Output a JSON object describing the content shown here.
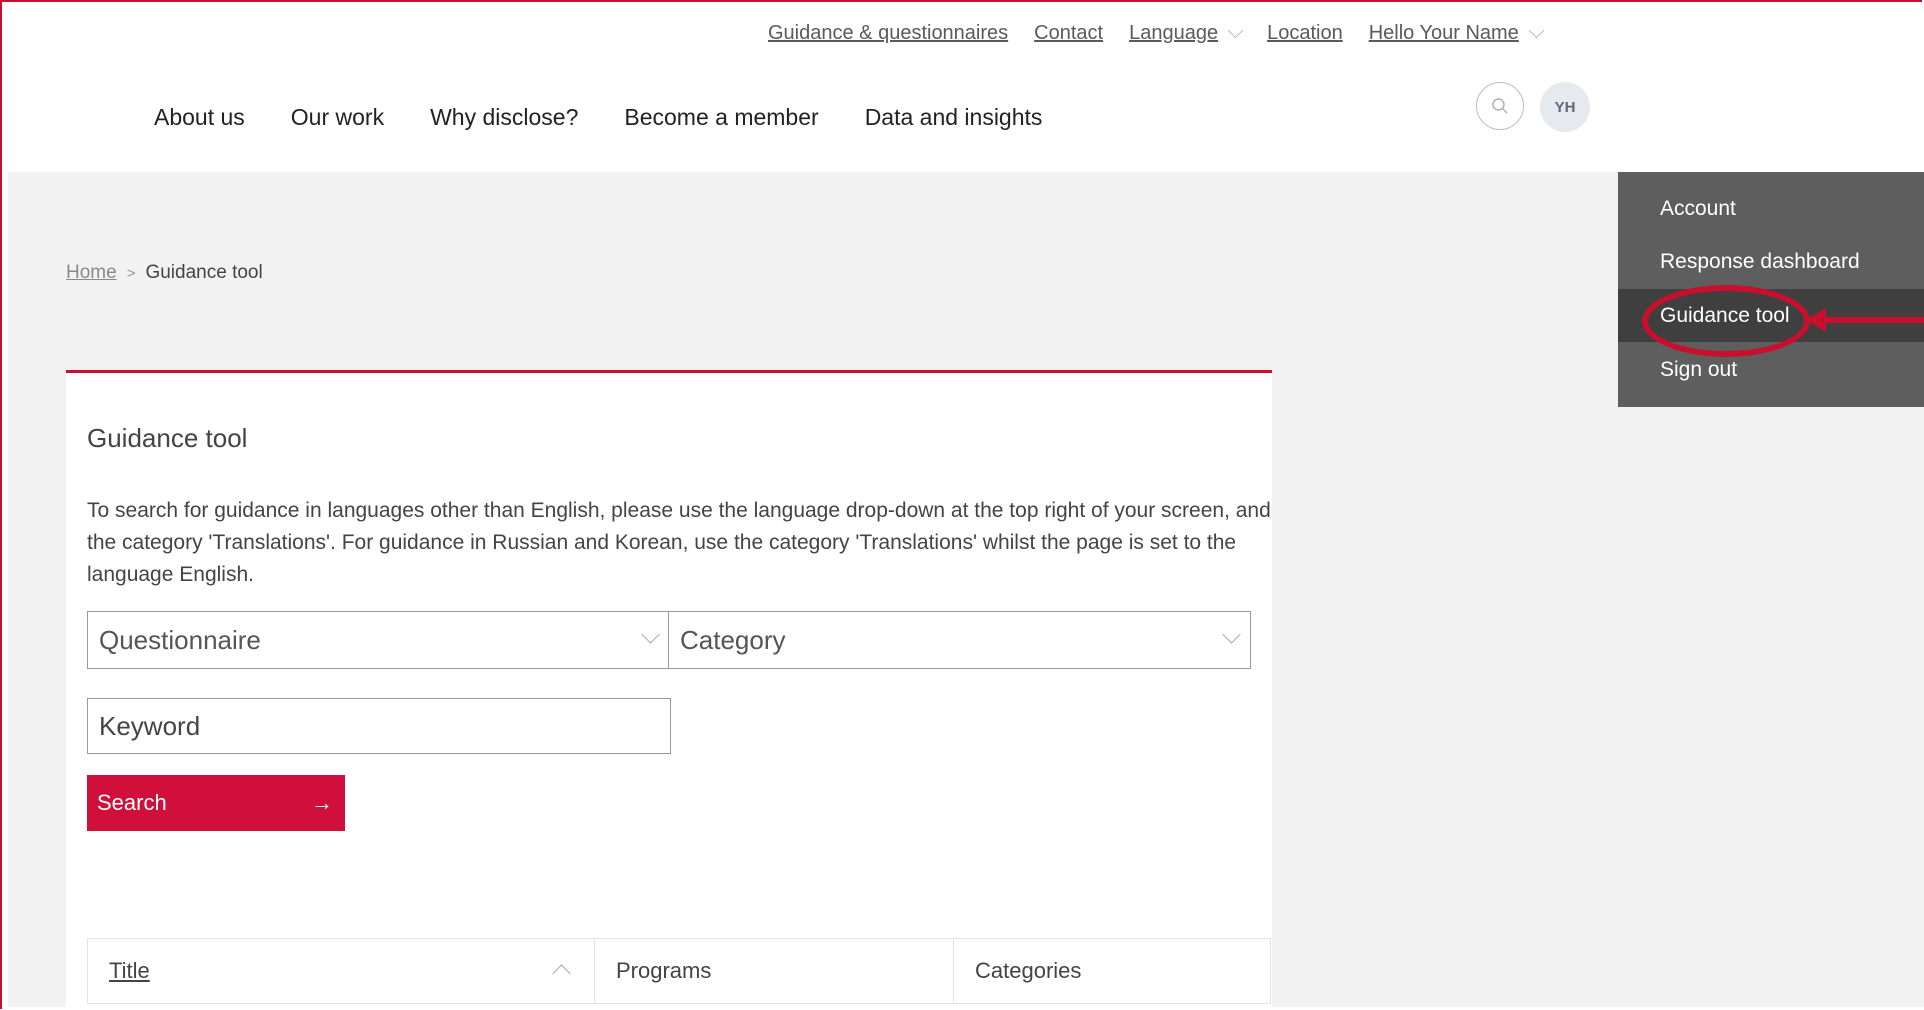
{
  "utility_nav": {
    "guidance": "Guidance & questionnaires",
    "contact": "Contact",
    "language": "Language",
    "location": "Location",
    "user_greeting": "Hello Your Name"
  },
  "main_nav": {
    "about": "About us",
    "work": "Our work",
    "why": "Why disclose?",
    "member": "Become a member",
    "data": "Data and insights"
  },
  "user": {
    "initials": "YH"
  },
  "account_menu": {
    "items": [
      "Account",
      "Response dashboard",
      "Guidance tool",
      "Sign out"
    ],
    "active": "Guidance tool"
  },
  "breadcrumb": {
    "home": "Home",
    "separator": ">",
    "current": "Guidance tool"
  },
  "card": {
    "title": "Guidance tool",
    "description": "To search for guidance in languages other than English, please use the language drop-down at the top right of your screen, and the category 'Translations'. For guidance in Russian and Korean, use the category 'Translations' whilst the page is set to the language English.",
    "questionnaire_placeholder": "Questionnaire",
    "category_placeholder": "Category",
    "keyword_placeholder": "Keyword",
    "search_label": "Search",
    "search_arrow": "→"
  },
  "table": {
    "headers": [
      "Title",
      "Programs",
      "Categories"
    ]
  },
  "colors": {
    "accent": "#c8102e",
    "button": "#d0103a",
    "menu_bg": "#5e5e5e",
    "menu_active": "#3f3f3f"
  }
}
